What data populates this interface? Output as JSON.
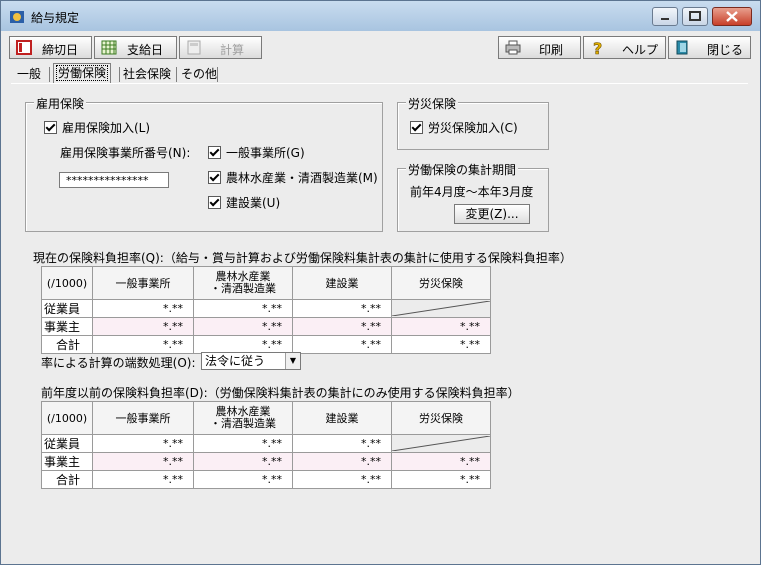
{
  "window": {
    "title": "給与規定"
  },
  "toolbar": {
    "cutoff_label": "締切日",
    "payday_label": "支給日",
    "calc_label": "計算",
    "print_label": "印刷",
    "help_label": "ヘルプ",
    "close_label": "閉じる"
  },
  "tabs": [
    "一般",
    "労働保険",
    "社会保険",
    "その他"
  ],
  "employment": {
    "title": "雇用保険",
    "join_label": "雇用保険加入(L)",
    "office_no_label": "雇用保険事業所番号(N):",
    "office_no_value": "***************",
    "general_label": "一般事業所(G)",
    "agri_label": "農林水産業・清酒製造業(M)",
    "construct_label": "建設業(U)"
  },
  "accident": {
    "title": "労災保険",
    "join_label": "労災保険加入(C)"
  },
  "period": {
    "title": "労働保険の集計期間",
    "value": "前年4月度～本年3月度",
    "change_label": "変更(Z)..."
  },
  "current": {
    "caption": "現在の保険料負担率(Q):（給与・賞与計算および労働保険料集計表の集計に使用する保険料負担率）",
    "unit": "(/1000)",
    "headers": [
      "一般事業所",
      "農林水産業\n・清酒製造業",
      "建設業",
      "労災保険"
    ],
    "rows": [
      {
        "label": "従業員",
        "values": [
          "*.**",
          "*.**",
          "*.**",
          ""
        ]
      },
      {
        "label": "事業主",
        "values": [
          "*.**",
          "*.**",
          "*.**",
          "*.**"
        ]
      },
      {
        "label": "合計",
        "values": [
          "*.**",
          "*.**",
          "*.**",
          "*.**"
        ]
      }
    ]
  },
  "rounding": {
    "label": "率による計算の端数処理(O):",
    "value": "法令に従う"
  },
  "previous": {
    "caption": "前年度以前の保険料負担率(D):（労働保険料集計表の集計にのみ使用する保険料負担率）",
    "unit": "(/1000)",
    "headers": [
      "一般事業所",
      "農林水産業\n・清酒製造業",
      "建設業",
      "労災保険"
    ],
    "rows": [
      {
        "label": "従業員",
        "values": [
          "*.**",
          "*.**",
          "*.**",
          ""
        ]
      },
      {
        "label": "事業主",
        "values": [
          "*.**",
          "*.**",
          "*.**",
          "*.**"
        ]
      },
      {
        "label": "合計",
        "values": [
          "*.**",
          "*.**",
          "*.**",
          "*.**"
        ]
      }
    ]
  },
  "colors": {
    "accent": "#a8c4e0",
    "close_button": "#c8402a",
    "pink_row": "#fbeff5"
  }
}
